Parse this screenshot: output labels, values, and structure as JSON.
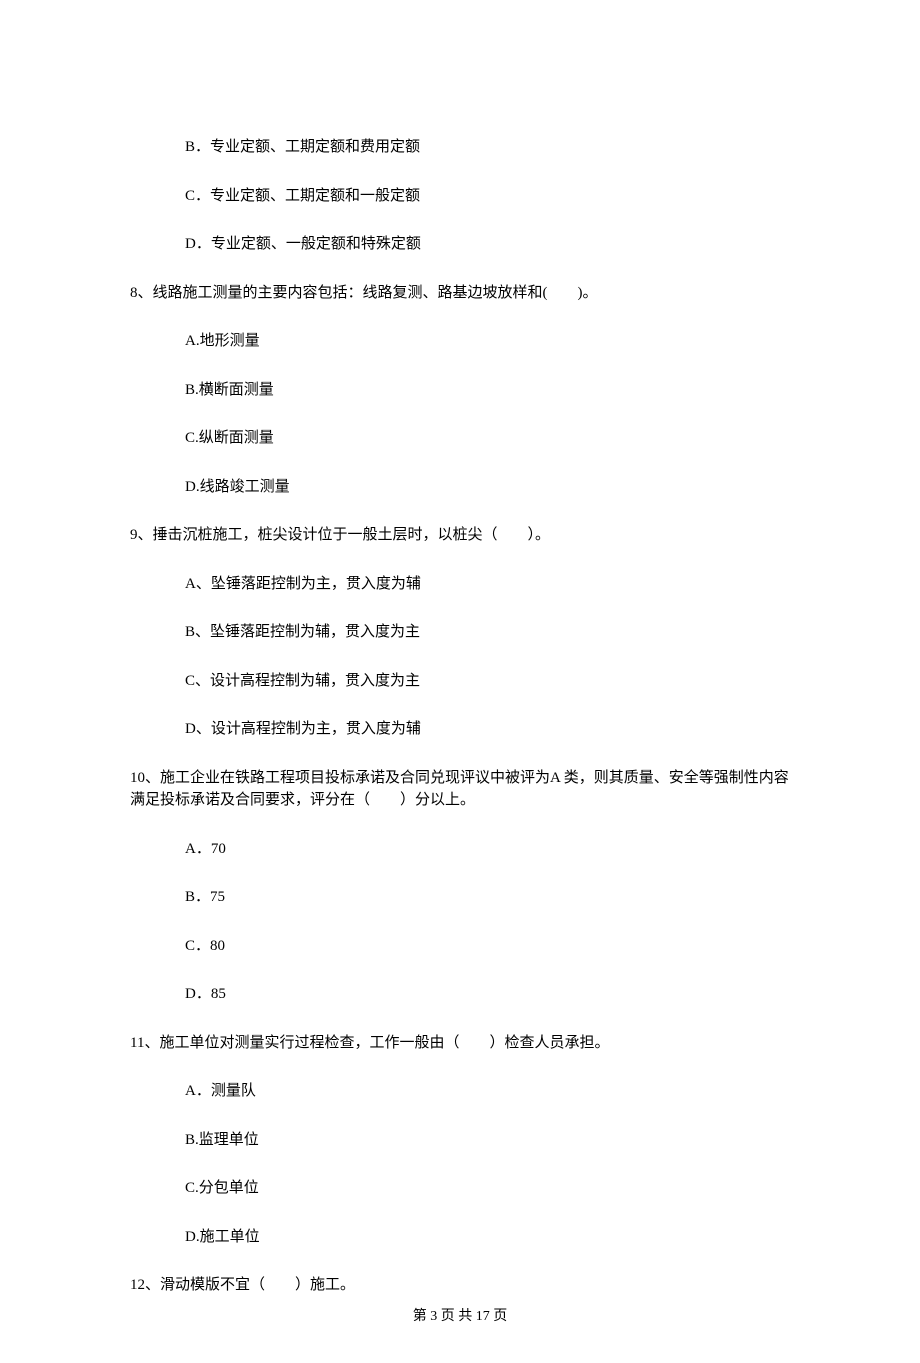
{
  "opts_top": {
    "b": "B．专业定额、工期定额和费用定额",
    "c": "C．专业定额、工期定额和一般定额",
    "d": "D．专业定额、一般定额和特殊定额"
  },
  "q8": {
    "stem": "8、线路施工测量的主要内容包括：线路复测、路基边坡放样和(　　)。",
    "a": "A.地形测量",
    "b": "B.横断面测量",
    "c": "C.纵断面测量",
    "d": "D.线路竣工测量"
  },
  "q9": {
    "stem": "9、捶击沉桩施工，桩尖设计位于一般土层时，以桩尖（　　）。",
    "a": "A、坠锤落距控制为主，贯入度为辅",
    "b": "B、坠锤落距控制为辅，贯入度为主",
    "c": "C、设计高程控制为辅，贯入度为主",
    "d": "D、设计高程控制为主，贯入度为辅"
  },
  "q10": {
    "stem": "10、施工企业在铁路工程项目投标承诺及合同兑现评议中被评为A 类，则其质量、安全等强制性内容满足投标承诺及合同要求，评分在（　　）分以上。",
    "a": "A．70",
    "b": "B．75",
    "c": "C．80",
    "d": "D．85"
  },
  "q11": {
    "stem": "11、施工单位对测量实行过程检查，工作一般由（　　）检查人员承担。",
    "a": "A．测量队",
    "b": "B.监理单位",
    "c": "C.分包单位",
    "d": "D.施工单位"
  },
  "q12": {
    "stem": "12、滑动模版不宜（　　）施工。"
  },
  "footer": "第 3 页 共 17 页"
}
